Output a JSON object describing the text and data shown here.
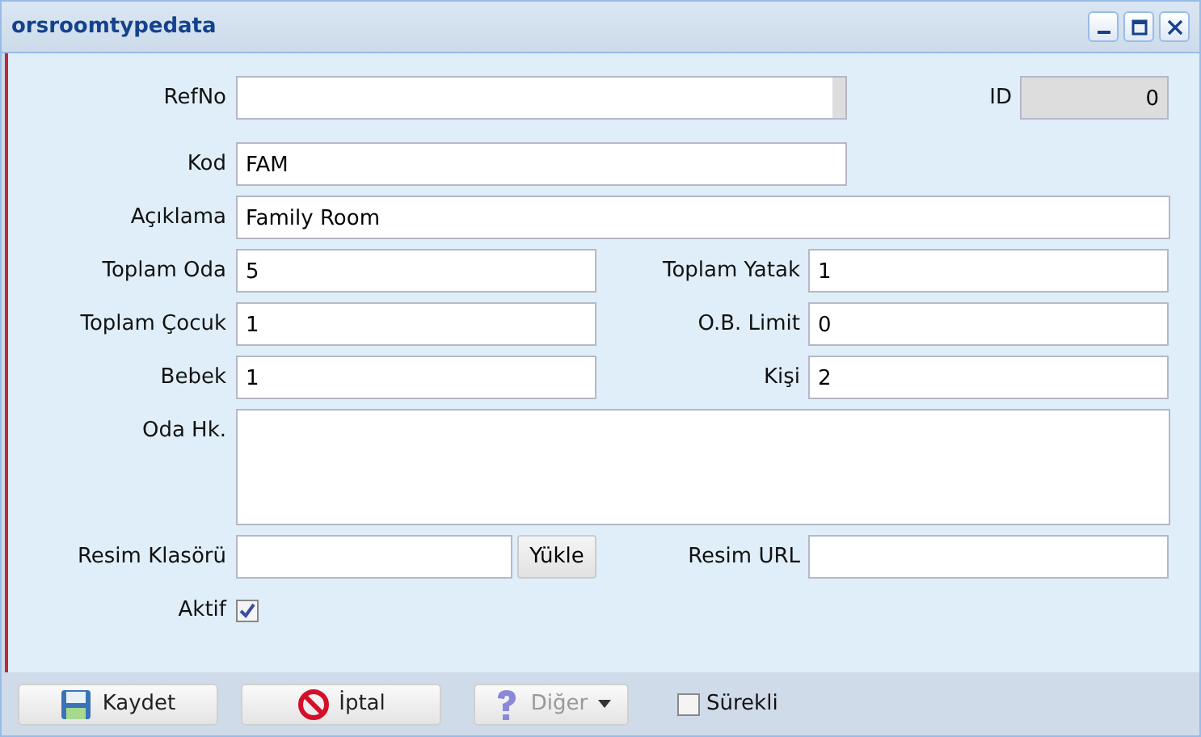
{
  "window": {
    "title": "orsroomtypedata"
  },
  "form": {
    "refno": {
      "label": "RefNo"
    },
    "id": {
      "label": "ID",
      "value": "0"
    },
    "kod": {
      "label": "Kod",
      "value": "FAM"
    },
    "aciklama": {
      "label": "Açıklama",
      "value": "Family Room"
    },
    "pairs": [
      [
        {
          "label": "Toplam Oda",
          "value": "5"
        },
        {
          "label": "Toplam Yatak",
          "value": "1"
        }
      ],
      [
        {
          "label": "Toplam Çocuk",
          "value": "1"
        },
        {
          "label": "O.B. Limit",
          "value": "0"
        }
      ],
      [
        {
          "label": "Bebek",
          "value": "1"
        },
        {
          "label": "Kişi",
          "value": "2"
        }
      ]
    ],
    "oda_hk": {
      "label": "Oda Hk."
    },
    "resim_klasoru": {
      "label": "Resim Klasörü",
      "button": "Yükle"
    },
    "resim_url": {
      "label": "Resim URL"
    },
    "aktif": {
      "label": "Aktif",
      "checked": true
    }
  },
  "footer": {
    "buttons": [
      {
        "label": "Kaydet",
        "kind": "save",
        "disabled": false
      },
      {
        "label": "İptal",
        "kind": "cancel",
        "disabled": false
      },
      {
        "label": "Diğer",
        "kind": "other",
        "disabled": true
      }
    ],
    "surekli": {
      "label": "Sürekli",
      "checked": false
    }
  }
}
